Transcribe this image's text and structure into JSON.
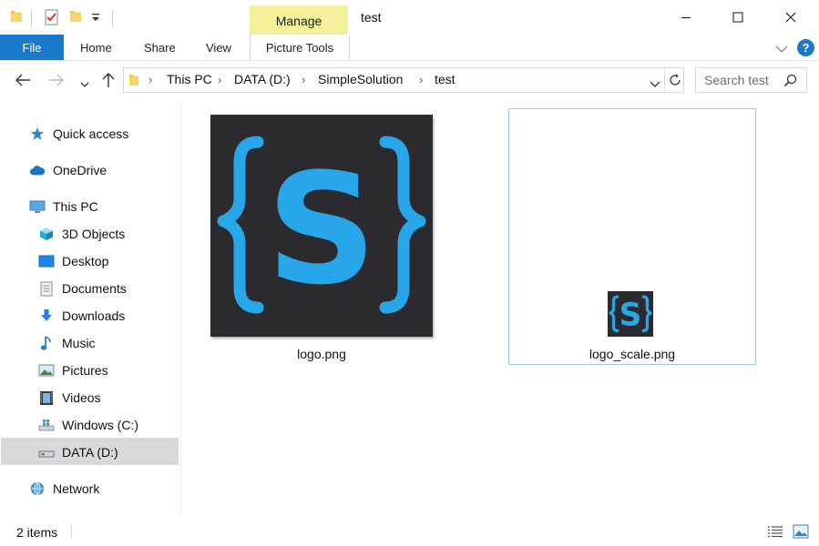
{
  "window": {
    "title": "test",
    "context_tab": "Manage"
  },
  "ribbon": {
    "file": "File",
    "tabs": [
      "Home",
      "Share",
      "View"
    ],
    "picture_tools": "Picture Tools"
  },
  "address": {
    "crumbs": [
      "This PC",
      "DATA (D:)",
      "SimpleSolution",
      "test"
    ]
  },
  "search": {
    "placeholder": "Search test"
  },
  "sidebar": {
    "items": [
      {
        "label": "Quick access",
        "icon": "star-icon"
      },
      {
        "label": "OneDrive",
        "icon": "cloud-icon"
      },
      {
        "label": "This PC",
        "icon": "computer-icon"
      },
      {
        "label": "3D Objects",
        "icon": "cube-icon"
      },
      {
        "label": "Desktop",
        "icon": "desktop-icon"
      },
      {
        "label": "Documents",
        "icon": "document-icon"
      },
      {
        "label": "Downloads",
        "icon": "download-icon"
      },
      {
        "label": "Music",
        "icon": "music-icon"
      },
      {
        "label": "Pictures",
        "icon": "pictures-icon"
      },
      {
        "label": "Videos",
        "icon": "video-icon"
      },
      {
        "label": "Windows (C:)",
        "icon": "drive-icon"
      },
      {
        "label": "DATA (D:)",
        "icon": "drive-icon"
      },
      {
        "label": "Network",
        "icon": "network-icon"
      }
    ]
  },
  "files": [
    {
      "name": "logo.png"
    },
    {
      "name": "logo_scale.png"
    }
  ],
  "status": {
    "count": "2 items"
  },
  "colors": {
    "accent": "#1979ca",
    "manage": "#f5f09a",
    "logo_blue": "#27a6e9",
    "logo_bg": "#2b2b2f"
  }
}
